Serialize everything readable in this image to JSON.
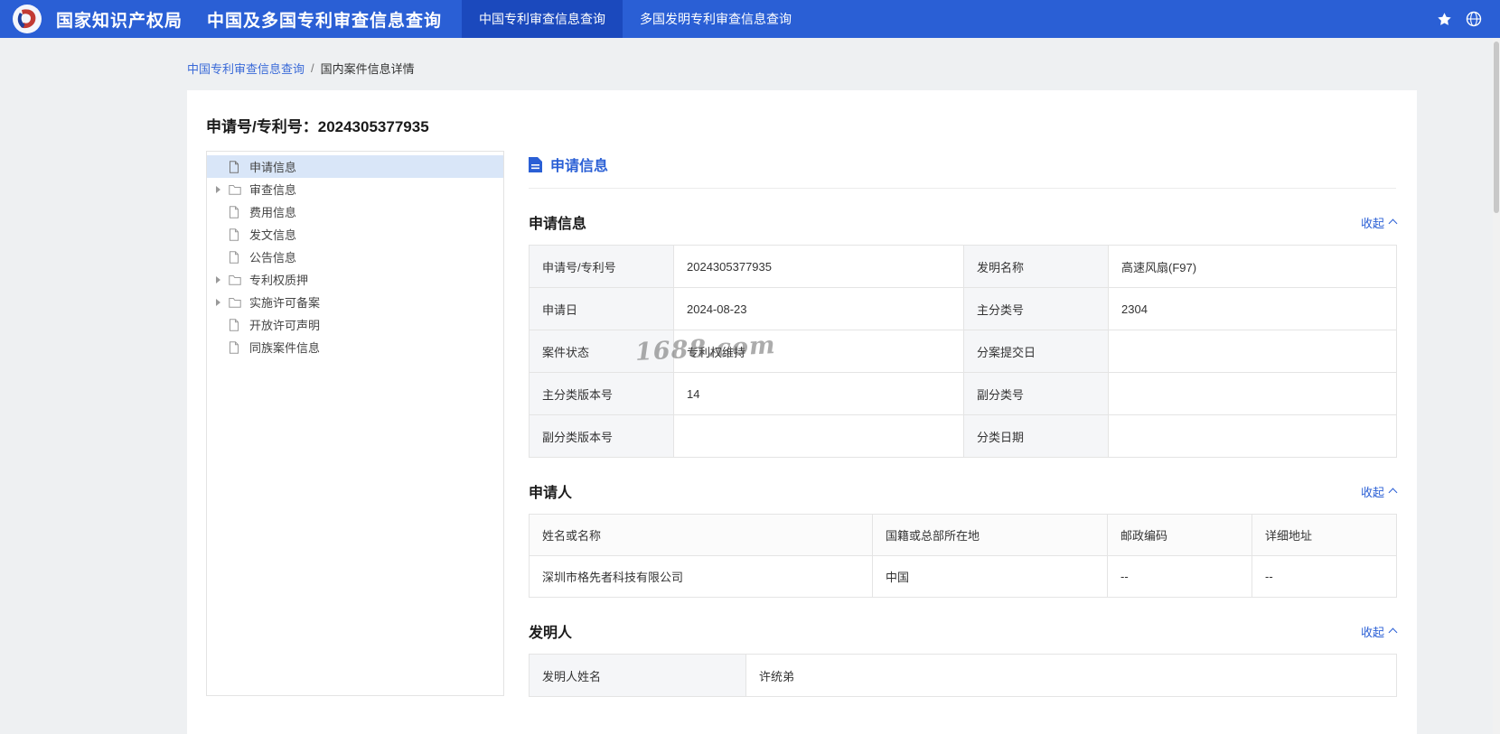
{
  "topbar": {
    "org_name": "国家知识产权局",
    "app_title": "中国及多国专利审查信息查询",
    "tabs": [
      {
        "label": "中国专利审查信息查询",
        "active": true
      },
      {
        "label": "多国发明专利审查信息查询",
        "active": false
      }
    ]
  },
  "icons": {
    "star-icon": "★",
    "globe-icon": "circle-with-meridians",
    "doc-icon": "document-outline",
    "folder-icon": "folder-outline",
    "tree-caret-icon": "▸",
    "collapse-caret-icon": "∧"
  },
  "breadcrumb": {
    "link": "中国专利审查信息查询",
    "separator": "/",
    "current": "国内案件信息详情"
  },
  "page_title": {
    "label": "申请号/专利号：",
    "value": "2024305377935"
  },
  "sidebar": {
    "items": [
      {
        "label": "申请信息",
        "icon": "doc-icon",
        "expandable": false,
        "selected": true
      },
      {
        "label": "审查信息",
        "icon": "folder-icon",
        "expandable": true,
        "selected": false
      },
      {
        "label": "费用信息",
        "icon": "doc-icon",
        "expandable": false,
        "selected": false
      },
      {
        "label": "发文信息",
        "icon": "doc-icon",
        "expandable": false,
        "selected": false
      },
      {
        "label": "公告信息",
        "icon": "doc-icon",
        "expandable": false,
        "selected": false
      },
      {
        "label": "专利权质押",
        "icon": "folder-icon",
        "expandable": true,
        "selected": false
      },
      {
        "label": "实施许可备案",
        "icon": "folder-icon",
        "expandable": true,
        "selected": false
      },
      {
        "label": "开放许可声明",
        "icon": "doc-icon",
        "expandable": false,
        "selected": false
      },
      {
        "label": "同族案件信息",
        "icon": "doc-icon",
        "expandable": false,
        "selected": false
      }
    ]
  },
  "content": {
    "panel_title": "申请信息",
    "watermark": "1688.com",
    "sections": {
      "application": {
        "title": "申请信息",
        "collapse_label": "收起"
      },
      "applicant": {
        "title": "申请人",
        "collapse_label": "收起"
      },
      "inventor": {
        "title": "发明人",
        "collapse_label": "收起"
      }
    },
    "application_table": {
      "rows": [
        {
          "l1": "申请号/专利号",
          "v1": "2024305377935",
          "l2": "发明名称",
          "v2": "高速风扇(F97)"
        },
        {
          "l1": "申请日",
          "v1": "2024-08-23",
          "l2": "主分类号",
          "v2": "2304"
        },
        {
          "l1": "案件状态",
          "v1": "专利权维持",
          "l2": "分案提交日",
          "v2": ""
        },
        {
          "l1": "主分类版本号",
          "v1": "14",
          "l2": "副分类号",
          "v2": ""
        },
        {
          "l1": "副分类版本号",
          "v1": "",
          "l2": "分类日期",
          "v2": ""
        }
      ]
    },
    "applicant_table": {
      "headers": [
        "姓名或名称",
        "国籍或总部所在地",
        "邮政编码",
        "详细地址"
      ],
      "row": [
        "深圳市格先者科技有限公司",
        "中国",
        "--",
        "--"
      ]
    },
    "inventor_table": {
      "label": "发明人姓名",
      "value": "许统弟"
    }
  },
  "colors": {
    "topbar_bg": "#2a5fd5",
    "active_tab_bg": "#1b49bd",
    "link_blue": "#2a5fd5",
    "selected_item_bg": "#d9e6f8",
    "label_cell_bg": "#f5f6f8",
    "border": "#e4e4e4"
  }
}
